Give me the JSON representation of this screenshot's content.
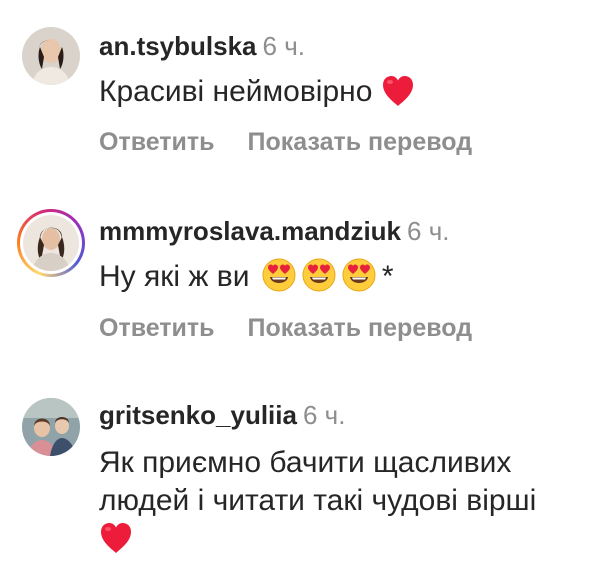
{
  "comments": [
    {
      "username": "an.tsybulska",
      "time": "6 ч.",
      "text": "Красиві неймовірно",
      "text_suffix_icon": "red-heart-icon",
      "reply_label": "Ответить",
      "translate_label": "Показать перевод",
      "has_story_ring": false
    },
    {
      "username": "mmmyroslava.mandziuk",
      "time": "6 ч.",
      "text": "Ну які ж ви",
      "text_suffix_icons": [
        "heart-eyes-emoji",
        "heart-eyes-emoji",
        "heart-eyes-emoji"
      ],
      "text_suffix": "*",
      "reply_label": "Ответить",
      "translate_label": "Показать перевод",
      "has_story_ring": true
    },
    {
      "username": "gritsenko_yuliia",
      "time": "6 ч.",
      "text_line1": "Як приємно бачити щасливих",
      "text_line2": "людей і читати такі чудові вірші",
      "text_suffix_icon": "red-heart-icon",
      "has_story_ring": false
    }
  ],
  "colors": {
    "text": "#262626",
    "muted": "#8e8e8e",
    "heart": "#ed1c3b"
  }
}
